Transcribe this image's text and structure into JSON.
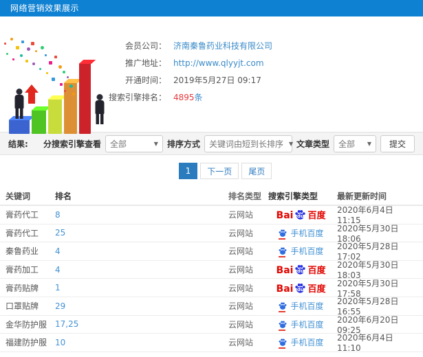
{
  "titlebar": {
    "title": "网络营销效果展示"
  },
  "info": {
    "fields": [
      {
        "label": "会员公司：",
        "value": "济南秦鲁药业科技有限公司"
      },
      {
        "label": "推广地址：",
        "value": "http://www.qlyyjt.com"
      },
      {
        "label": "开通时间：",
        "value": "2019年5月27日 09:17"
      },
      {
        "label": "搜索引擎排名：",
        "value": "4895",
        "suffix": "条"
      }
    ]
  },
  "filters": {
    "result_label": "结果:",
    "engine_view_label": "分搜索引擎查看",
    "engine_view_value": "全部",
    "sort_label": "排序方式",
    "sort_value": "关键词由短到长排序",
    "article_type_label": "文章类型",
    "article_type_value": "全部",
    "submit_label": "提交",
    "caret": "▼"
  },
  "pagination": {
    "current": "1",
    "next_label": "下一页",
    "last_label": "尾页"
  },
  "table": {
    "headers": [
      "关键词",
      "排名",
      "排名类型",
      "搜索引擎类型",
      "最新更新时间"
    ],
    "baidu_logo": {
      "bai": "Bai",
      "du": "du",
      "cn": "百度"
    },
    "mobile_label": "手机百度",
    "rows": [
      {
        "keyword": "膏药代工",
        "rank": "8",
        "rank_type": "云网站",
        "engine_kind": "baidu",
        "updated": "2020年6月4日 11:15"
      },
      {
        "keyword": "膏药代工",
        "rank": "25",
        "rank_type": "云网站",
        "engine_kind": "mobile",
        "updated": "2020年5月30日 18:06"
      },
      {
        "keyword": "秦鲁药业",
        "rank": "4",
        "rank_type": "云网站",
        "engine_kind": "mobile",
        "updated": "2020年5月28日 17:02"
      },
      {
        "keyword": "膏药加工",
        "rank": "4",
        "rank_type": "云网站",
        "engine_kind": "baidu",
        "updated": "2020年5月30日 18:03"
      },
      {
        "keyword": "膏药贴牌",
        "rank": "1",
        "rank_type": "云网站",
        "engine_kind": "baidu",
        "updated": "2020年5月30日 17:58"
      },
      {
        "keyword": "口罩贴牌",
        "rank": "29",
        "rank_type": "云网站",
        "engine_kind": "mobile",
        "updated": "2020年5月28日 16:55"
      },
      {
        "keyword": "金华防护服",
        "rank": "17,25",
        "rank_type": "云网站",
        "engine_kind": "mobile",
        "updated": "2020年6月20日 09:25"
      },
      {
        "keyword": "福建防护服",
        "rank": "10",
        "rank_type": "云网站",
        "engine_kind": "mobile",
        "updated": "2020年6月4日 11:10"
      }
    ]
  },
  "colors": {
    "header_bg": "#0f81d2",
    "link_blue": "#3a8ac8",
    "rank_blue": "#4291d4",
    "red": "#e4393c",
    "baidu_red": "#e10601",
    "baidu_blue": "#2932e1",
    "page_active": "#2b7cbe",
    "filter_bg": "#f4f4f4"
  }
}
